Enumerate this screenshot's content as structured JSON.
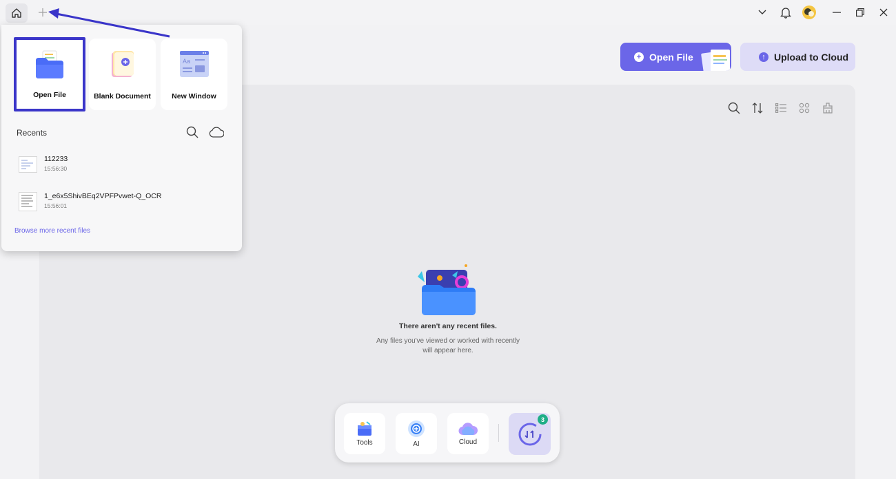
{
  "titlebar": {
    "icons": [
      "home-icon",
      "plus-icon",
      "chevron-down-icon",
      "bell-icon",
      "avatar",
      "minimize-icon",
      "restore-icon",
      "close-icon"
    ]
  },
  "actions": {
    "open_file_label": "Open File",
    "upload_label": "Upload to Cloud"
  },
  "popup": {
    "tiles": [
      {
        "label": "Open File",
        "icon": "folder-icon"
      },
      {
        "label": "Blank Document",
        "icon": "blank-document-icon"
      },
      {
        "label": "New Window",
        "icon": "new-window-icon"
      }
    ],
    "recents_title": "Recents",
    "recents": [
      {
        "name": "112233",
        "time": "15:56:30"
      },
      {
        "name": "1_e6x5ShivBEq2VPFPvwet-Q_OCR",
        "time": "15:56:01"
      }
    ],
    "browse_label": "Browse more recent files"
  },
  "empty_state": {
    "title": "There aren't any recent files.",
    "description": "Any files you've viewed or worked with recently will appear here."
  },
  "dock": {
    "items": [
      {
        "label": "Tools",
        "icon": "tools-icon"
      },
      {
        "label": "AI",
        "icon": "ai-icon"
      },
      {
        "label": "Cloud",
        "icon": "cloud-icon"
      }
    ],
    "sync_badge": "3"
  },
  "colors": {
    "accent": "#6b66e8",
    "highlight_border": "#3a35c9",
    "badge": "#1fae87"
  }
}
